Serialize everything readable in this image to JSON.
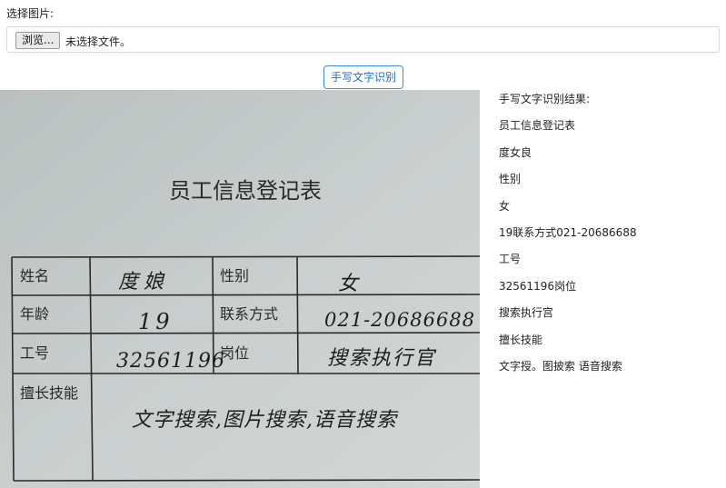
{
  "upload": {
    "label": "选择图片:",
    "browse_label": "浏览...",
    "status": "未选择文件。"
  },
  "ocr_button": "手写文字识别",
  "photo": {
    "title": "员工信息登记表",
    "form": {
      "name_label": "姓名",
      "name_value": "度娘",
      "gender_label": "性别",
      "gender_value": "女",
      "age_label": "年龄",
      "age_value": "19",
      "contact_label": "联系方式",
      "contact_value": "021-20686688",
      "id_label": "工号",
      "id_value": "32561196",
      "post_label": "岗位",
      "post_value": "搜索执行官",
      "skills_label": "擅长技能",
      "skills_value": "文字搜索,图片搜索,语音搜索"
    }
  },
  "results": {
    "title": "手写文字识别结果:",
    "lines": [
      "员工信息登记表",
      "度女良",
      "性别",
      "女",
      "19联系方式021-20686688",
      "工号",
      "32561196岗位",
      "搜索执行宫",
      "擅长技能",
      "文字授。图披索 语音搜索"
    ]
  }
}
